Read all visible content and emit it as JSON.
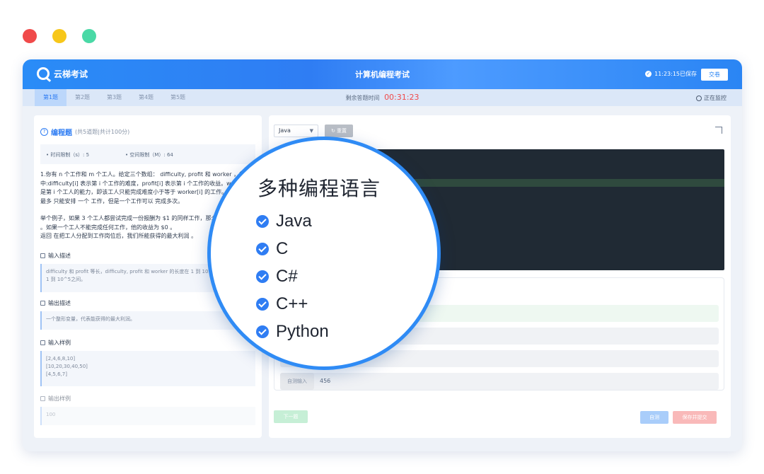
{
  "window": {
    "dots": [
      "#f04a4a",
      "#f7c71a",
      "#4ad9a6"
    ]
  },
  "topbar": {
    "logo": "云梯考试",
    "title": "计算机编程考试",
    "saved_text": "11:23:15已保存",
    "submit_label": "交卷"
  },
  "tabbar": {
    "tabs": [
      "第1题",
      "第2题",
      "第3题",
      "第4题",
      "第5题"
    ],
    "active_tab": 0,
    "timer_label": "剩余答题时间",
    "timer_value": "00:31:23",
    "monitor_label": "正在监控"
  },
  "question": {
    "title": "编程题",
    "subtitle": "(共5道题|共计100分)",
    "time_limit": "• 时间限制（s）:  5",
    "space_limit": "• 空间限制（M）:  64",
    "desc_p1": "1.你有 n 个工作和 m 个工人。给定三个数组： difficulty, profit 和 worker ，其中:difficulty[i] 表示第 i 个工作的难度，profit[i] 表示第 i 个工作的收益。worker[i] 是第 i 个工人的能力，即该工人只能完成难度小于等于 worker[i] 的工作。每个工人 最多 只能安排 一个 工作，但是一个工作可以 完成多次。",
    "desc_p2": "举个例子，如果 3 个工人都尝试完成一份报酬为 $1 的同样工作，那么总收益为 $3 。如果一个工人不能完成任何工作，他的收益为 $0 。",
    "desc_p3": "返回 在把工人分配到工作岗位后，我们所能获得的最大利润 。",
    "input_desc_title": "输入描述",
    "input_desc": "difficulty 和 profit 等长，difficulty, profit 和 worker 的长度在 1 到 10^4 之间，大小在 1 到 10^5之间。",
    "output_desc_title": "输出描述",
    "output_desc": "一个整形变量，代表能获得的最大利润。",
    "input_sample_title": "输入样例",
    "input_sample": [
      "[2,4,6,8,10]",
      "[10,20,30,40,50]",
      "[4,5,6,7]"
    ],
    "output_sample_title": "输出样例",
    "output_sample": "100"
  },
  "editor": {
    "language": "Java",
    "reset_label": "重置",
    "self_test_label": "自测输入",
    "self_test_value": "456",
    "next_label": "下一题",
    "run_label": "自测",
    "save_submit_label": "保存并提交"
  },
  "magnifier": {
    "title": "多种编程语言",
    "languages": [
      "Java",
      "C",
      "C#",
      "C++",
      "Python"
    ]
  }
}
